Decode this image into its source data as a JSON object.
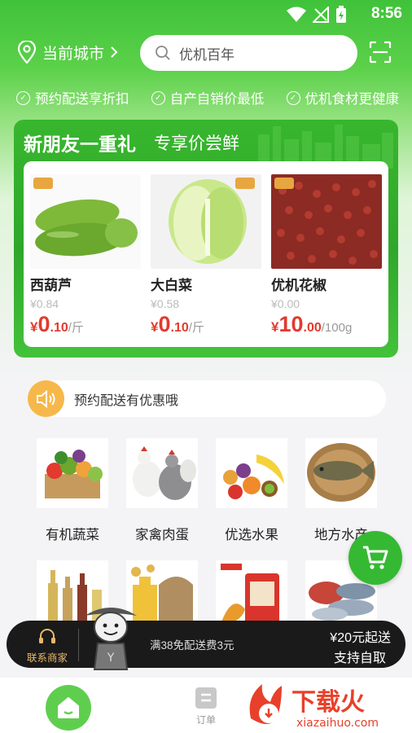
{
  "status": {
    "time": "8:56"
  },
  "header": {
    "city_label": "当前城市",
    "search_placeholder": "优机百年"
  },
  "promises": [
    "预约配送享折扣",
    "自产自销价最低",
    "优机食材更健康"
  ],
  "promo": {
    "title": "新朋友一重礼",
    "subtitle": "专享价尝鲜",
    "products": [
      {
        "name": "西葫芦",
        "old_price": "¥0.84",
        "symbol": "¥",
        "price_int": "0",
        "price_dec": ".10",
        "unit": "/斤"
      },
      {
        "name": "大白菜",
        "old_price": "¥0.58",
        "symbol": "¥",
        "price_int": "0",
        "price_dec": ".10",
        "unit": "/斤"
      },
      {
        "name": "优机花椒",
        "old_price": "¥0.00",
        "symbol": "¥",
        "price_int": "10",
        "price_dec": ".00",
        "unit": "/100g"
      }
    ]
  },
  "notice": {
    "text": "预约配送有优惠哦"
  },
  "categories": [
    {
      "label": "有机蔬菜"
    },
    {
      "label": "家禽肉蛋"
    },
    {
      "label": "优选水果"
    },
    {
      "label": "地方水产"
    }
  ],
  "bottom_bar": {
    "contact_label": "联系商家",
    "free_shipping": "满38免配送费3元",
    "min_order": "¥20元起送",
    "self_pickup": "支持自取"
  },
  "tabbar": {
    "order_label": "订单"
  },
  "watermark": {
    "brand": "下载火",
    "url": "xiazaihuo.com"
  },
  "colors": {
    "brand_green": "#35b932",
    "price_red": "#e23a2e",
    "notice_orange": "#f6b84a"
  }
}
